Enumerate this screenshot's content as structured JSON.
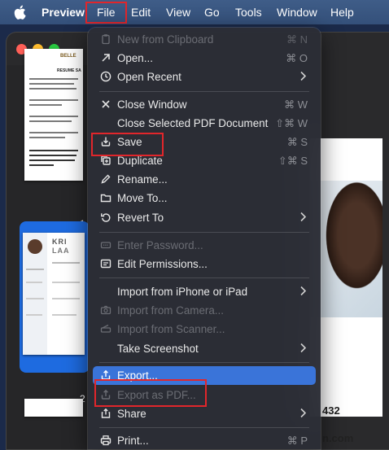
{
  "menubar": {
    "app": "Preview",
    "items": [
      "File",
      "Edit",
      "View",
      "Go",
      "Tools",
      "Window",
      "Help"
    ]
  },
  "menu": {
    "items": [
      {
        "label": "New from Clipboard",
        "shortcut": "⌘ N",
        "icon": "clipboard-icon",
        "disabled": true
      },
      {
        "label": "Open...",
        "shortcut": "⌘ O",
        "icon": "open-arrow-icon"
      },
      {
        "label": "Open Recent",
        "icon": "clock-icon",
        "submenu": true
      },
      {
        "label": "Close Window",
        "shortcut": "⌘ W",
        "icon": "close-x-icon"
      },
      {
        "label": "Close Selected PDF Document",
        "shortcut": "⇧⌘ W"
      },
      {
        "label": "Save",
        "shortcut": "⌘ S",
        "icon": "save-icon"
      },
      {
        "label": "Duplicate",
        "shortcut": "⇧⌘ S",
        "icon": "duplicate-icon"
      },
      {
        "label": "Rename...",
        "icon": "pencil-icon"
      },
      {
        "label": "Move To...",
        "icon": "folder-icon"
      },
      {
        "label": "Revert To",
        "icon": "revert-icon",
        "submenu": true
      },
      {
        "label": "Enter Password...",
        "icon": "password-icon",
        "disabled": true
      },
      {
        "label": "Edit Permissions...",
        "icon": "permissions-icon"
      },
      {
        "label": "Import from iPhone or iPad",
        "submenu": true
      },
      {
        "label": "Import from Camera...",
        "icon": "camera-icon",
        "disabled": true
      },
      {
        "label": "Import from Scanner...",
        "icon": "scanner-icon",
        "disabled": true
      },
      {
        "label": "Take Screenshot",
        "submenu": true
      },
      {
        "label": "Export...",
        "icon": "export-icon",
        "active": true
      },
      {
        "label": "Export as PDF...",
        "icon": "export-pdf-icon",
        "disabled": true
      },
      {
        "label": "Share",
        "icon": "share-icon",
        "submenu": true
      },
      {
        "label": "Print...",
        "shortcut": "⌘ P",
        "icon": "print-icon"
      }
    ]
  },
  "sidebar": {
    "pages": [
      "1",
      "2"
    ],
    "thumb1_title": "RESUME SA",
    "thumb1_heading": "BELLE",
    "thumb2_name": "KRI",
    "thumb2_name2": "LAA"
  },
  "document": {
    "fragment1": "432",
    "fragment2": "n.com"
  },
  "colors": {
    "accent": "#3a74d9",
    "highlight_box": "#e1262b"
  }
}
